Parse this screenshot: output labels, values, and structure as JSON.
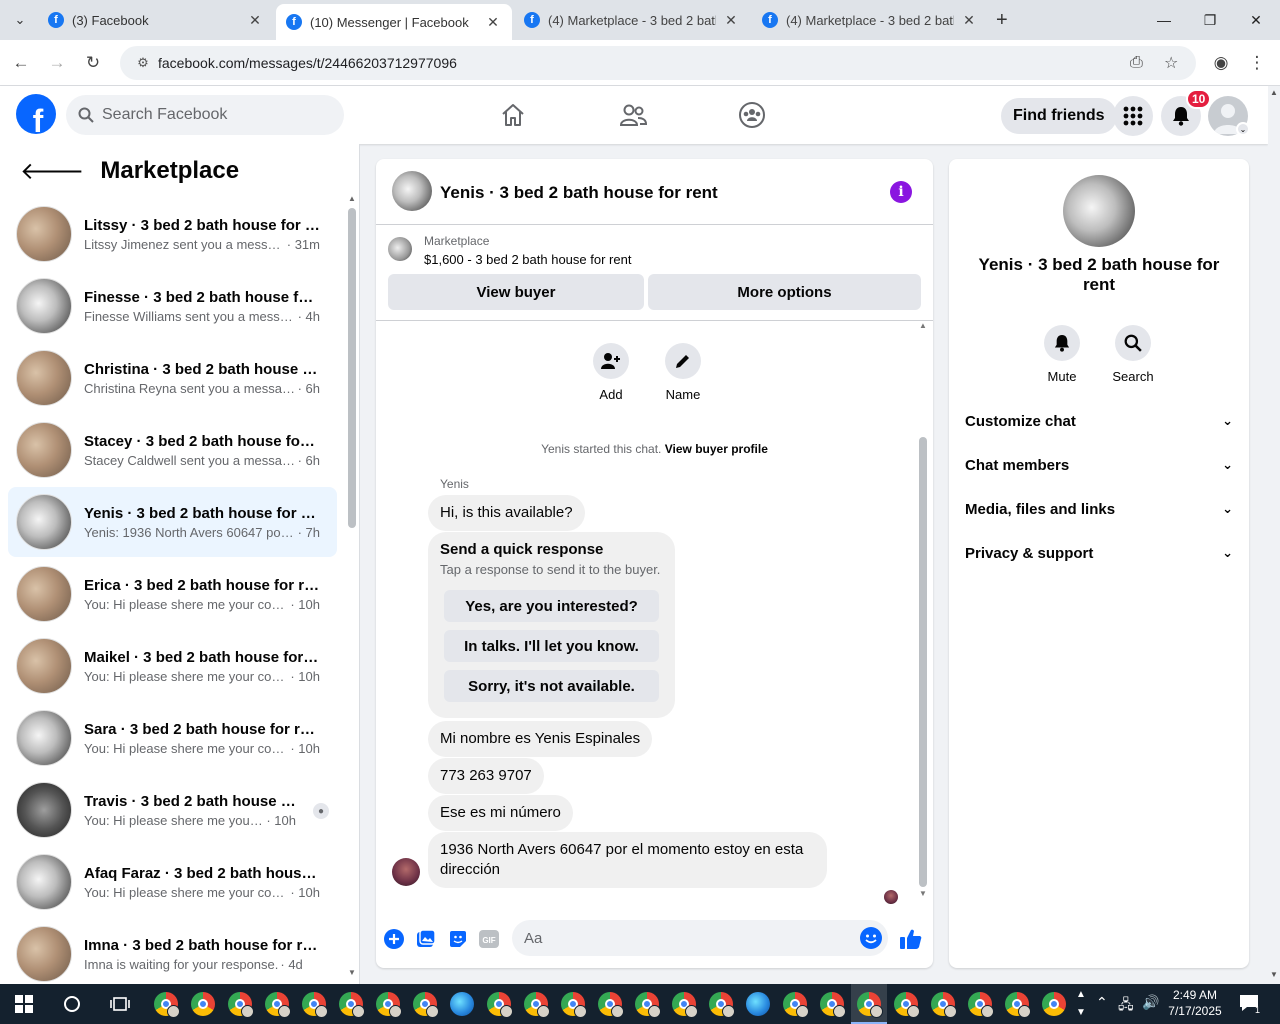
{
  "browser": {
    "tabs": [
      {
        "title": "(3) Facebook",
        "active": false
      },
      {
        "title": "(10) Messenger | Facebook",
        "active": true
      },
      {
        "title": "(4) Marketplace - 3 bed 2 bath h",
        "active": false
      },
      {
        "title": "(4) Marketplace - 3 bed 2 bath h",
        "active": false
      }
    ],
    "url": "facebook.com/messages/t/24466203712977096"
  },
  "fb_header": {
    "logo": "f",
    "search_placeholder": "Search Facebook",
    "find_friends": "Find friends",
    "notifications_count": "10"
  },
  "left_panel": {
    "title": "Marketplace",
    "conversations": [
      {
        "name": "Litssy · 3 bed 2 bath house for rent",
        "snippet": "Litssy Jimenez sent you a messag...",
        "time": "· 31m",
        "thumb": "room",
        "active": false
      },
      {
        "name": "Finesse · 3 bed 2 bath house for rent",
        "snippet": "Finesse Williams sent you a messag...",
        "time": "· 4h",
        "thumb": "kitchen",
        "active": false
      },
      {
        "name": "Christina · 3 bed 2 bath house for rent",
        "snippet": "Christina Reyna sent you a messag...",
        "time": "· 6h",
        "thumb": "room",
        "active": false
      },
      {
        "name": "Stacey · 3 bed 2 bath house for rent",
        "snippet": "Stacey Caldwell sent you a messag...",
        "time": "· 6h",
        "thumb": "room",
        "active": false
      },
      {
        "name": "Yenis · 3 bed 2 bath house for rent",
        "snippet": "Yenis: 1936 North Avers 60647 por ...",
        "time": "· 7h",
        "thumb": "kitchen",
        "active": true
      },
      {
        "name": "Erica · 3 bed 2 bath house for rent",
        "snippet": "You: Hi please shere me your cont...",
        "time": "· 10h",
        "thumb": "room",
        "active": false
      },
      {
        "name": "Maikel · 3 bed 2 bath house for rent",
        "snippet": "You: Hi please shere me your cont...",
        "time": "· 10h",
        "thumb": "room",
        "active": false
      },
      {
        "name": "Sara · 3 bed 2 bath house for rent",
        "snippet": "You: Hi please shere me your cont...",
        "time": "· 10h",
        "thumb": "kitchen",
        "active": false
      },
      {
        "name": "Travis · 3 bed 2 bath house for rent",
        "snippet": "You: Hi please shere me your c...",
        "time": "· 10h",
        "thumb": "dark",
        "active": false
      },
      {
        "name": "Afaq Faraz · 3 bed 2 bath house for rent",
        "snippet": "You: Hi please shere me your cont...",
        "time": "· 10h",
        "thumb": "kitchen",
        "active": false
      },
      {
        "name": "Imna · 3 bed 2 bath house for rent",
        "snippet": "Imna is waiting for your response.",
        "time": "· 4d",
        "thumb": "room",
        "active": false
      }
    ]
  },
  "chat": {
    "title": "Yenis · 3 bed 2 bath house for rent",
    "listing_label": "Marketplace",
    "listing_price": "$1,600 - 3 bed 2 bath house for rent",
    "view_buyer": "View buyer",
    "more_options": "More options",
    "actions": {
      "add": "Add",
      "name": "Name"
    },
    "started_text": "Yenis started this chat.",
    "view_profile": "View buyer profile",
    "sender_name": "Yenis",
    "first_message": "Hi, is this available?",
    "quick": {
      "title": "Send a quick response",
      "subtitle": "Tap a response to send it to the buyer.",
      "options": [
        "Yes, are you interested?",
        "In talks. I'll let you know.",
        "Sorry, it's not available."
      ]
    },
    "messages": [
      "Mi nombre es Yenis Espinales",
      "773 263 9707",
      "Ese es mi número",
      "1936 North Avers 60647 por el momento estoy en esta dirección"
    ],
    "composer_placeholder": "Aa"
  },
  "right_panel": {
    "name": "Yenis · 3 bed 2 bath house for rent",
    "mute": "Mute",
    "search": "Search",
    "sections": [
      "Customize chat",
      "Chat members",
      "Media, files and links",
      "Privacy & support"
    ]
  },
  "taskbar": {
    "time": "2:49 AM",
    "date": "7/17/2025",
    "notification_count": "1"
  }
}
